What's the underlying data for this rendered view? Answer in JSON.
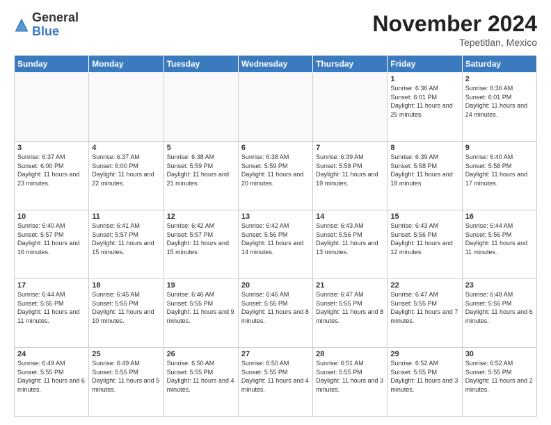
{
  "header": {
    "logo_general": "General",
    "logo_blue": "Blue",
    "title": "November 2024",
    "location": "Tepetitlan, Mexico"
  },
  "calendar": {
    "days_of_week": [
      "Sunday",
      "Monday",
      "Tuesday",
      "Wednesday",
      "Thursday",
      "Friday",
      "Saturday"
    ],
    "weeks": [
      [
        {
          "day": "",
          "empty": true
        },
        {
          "day": "",
          "empty": true
        },
        {
          "day": "",
          "empty": true
        },
        {
          "day": "",
          "empty": true
        },
        {
          "day": "",
          "empty": true
        },
        {
          "day": "1",
          "sunrise": "Sunrise: 6:36 AM",
          "sunset": "Sunset: 6:01 PM",
          "daylight": "Daylight: 11 hours and 25 minutes."
        },
        {
          "day": "2",
          "sunrise": "Sunrise: 6:36 AM",
          "sunset": "Sunset: 6:01 PM",
          "daylight": "Daylight: 11 hours and 24 minutes."
        }
      ],
      [
        {
          "day": "3",
          "sunrise": "Sunrise: 6:37 AM",
          "sunset": "Sunset: 6:00 PM",
          "daylight": "Daylight: 11 hours and 23 minutes."
        },
        {
          "day": "4",
          "sunrise": "Sunrise: 6:37 AM",
          "sunset": "Sunset: 6:00 PM",
          "daylight": "Daylight: 11 hours and 22 minutes."
        },
        {
          "day": "5",
          "sunrise": "Sunrise: 6:38 AM",
          "sunset": "Sunset: 5:59 PM",
          "daylight": "Daylight: 11 hours and 21 minutes."
        },
        {
          "day": "6",
          "sunrise": "Sunrise: 6:38 AM",
          "sunset": "Sunset: 5:59 PM",
          "daylight": "Daylight: 11 hours and 20 minutes."
        },
        {
          "day": "7",
          "sunrise": "Sunrise: 6:39 AM",
          "sunset": "Sunset: 5:58 PM",
          "daylight": "Daylight: 11 hours and 19 minutes."
        },
        {
          "day": "8",
          "sunrise": "Sunrise: 6:39 AM",
          "sunset": "Sunset: 5:58 PM",
          "daylight": "Daylight: 11 hours and 18 minutes."
        },
        {
          "day": "9",
          "sunrise": "Sunrise: 6:40 AM",
          "sunset": "Sunset: 5:58 PM",
          "daylight": "Daylight: 11 hours and 17 minutes."
        }
      ],
      [
        {
          "day": "10",
          "sunrise": "Sunrise: 6:40 AM",
          "sunset": "Sunset: 5:57 PM",
          "daylight": "Daylight: 11 hours and 16 minutes."
        },
        {
          "day": "11",
          "sunrise": "Sunrise: 6:41 AM",
          "sunset": "Sunset: 5:57 PM",
          "daylight": "Daylight: 11 hours and 15 minutes."
        },
        {
          "day": "12",
          "sunrise": "Sunrise: 6:42 AM",
          "sunset": "Sunset: 5:57 PM",
          "daylight": "Daylight: 11 hours and 15 minutes."
        },
        {
          "day": "13",
          "sunrise": "Sunrise: 6:42 AM",
          "sunset": "Sunset: 5:56 PM",
          "daylight": "Daylight: 11 hours and 14 minutes."
        },
        {
          "day": "14",
          "sunrise": "Sunrise: 6:43 AM",
          "sunset": "Sunset: 5:56 PM",
          "daylight": "Daylight: 11 hours and 13 minutes."
        },
        {
          "day": "15",
          "sunrise": "Sunrise: 6:43 AM",
          "sunset": "Sunset: 5:56 PM",
          "daylight": "Daylight: 11 hours and 12 minutes."
        },
        {
          "day": "16",
          "sunrise": "Sunrise: 6:44 AM",
          "sunset": "Sunset: 5:56 PM",
          "daylight": "Daylight: 11 hours and 11 minutes."
        }
      ],
      [
        {
          "day": "17",
          "sunrise": "Sunrise: 6:44 AM",
          "sunset": "Sunset: 5:55 PM",
          "daylight": "Daylight: 11 hours and 11 minutes."
        },
        {
          "day": "18",
          "sunrise": "Sunrise: 6:45 AM",
          "sunset": "Sunset: 5:55 PM",
          "daylight": "Daylight: 11 hours and 10 minutes."
        },
        {
          "day": "19",
          "sunrise": "Sunrise: 6:46 AM",
          "sunset": "Sunset: 5:55 PM",
          "daylight": "Daylight: 11 hours and 9 minutes."
        },
        {
          "day": "20",
          "sunrise": "Sunrise: 6:46 AM",
          "sunset": "Sunset: 5:55 PM",
          "daylight": "Daylight: 11 hours and 8 minutes."
        },
        {
          "day": "21",
          "sunrise": "Sunrise: 6:47 AM",
          "sunset": "Sunset: 5:55 PM",
          "daylight": "Daylight: 11 hours and 8 minutes."
        },
        {
          "day": "22",
          "sunrise": "Sunrise: 6:47 AM",
          "sunset": "Sunset: 5:55 PM",
          "daylight": "Daylight: 11 hours and 7 minutes."
        },
        {
          "day": "23",
          "sunrise": "Sunrise: 6:48 AM",
          "sunset": "Sunset: 5:55 PM",
          "daylight": "Daylight: 11 hours and 6 minutes."
        }
      ],
      [
        {
          "day": "24",
          "sunrise": "Sunrise: 6:49 AM",
          "sunset": "Sunset: 5:55 PM",
          "daylight": "Daylight: 11 hours and 6 minutes."
        },
        {
          "day": "25",
          "sunrise": "Sunrise: 6:49 AM",
          "sunset": "Sunset: 5:55 PM",
          "daylight": "Daylight: 11 hours and 5 minutes."
        },
        {
          "day": "26",
          "sunrise": "Sunrise: 6:50 AM",
          "sunset": "Sunset: 5:55 PM",
          "daylight": "Daylight: 11 hours and 4 minutes."
        },
        {
          "day": "27",
          "sunrise": "Sunrise: 6:50 AM",
          "sunset": "Sunset: 5:55 PM",
          "daylight": "Daylight: 11 hours and 4 minutes."
        },
        {
          "day": "28",
          "sunrise": "Sunrise: 6:51 AM",
          "sunset": "Sunset: 5:55 PM",
          "daylight": "Daylight: 11 hours and 3 minutes."
        },
        {
          "day": "29",
          "sunrise": "Sunrise: 6:52 AM",
          "sunset": "Sunset: 5:55 PM",
          "daylight": "Daylight: 11 hours and 3 minutes."
        },
        {
          "day": "30",
          "sunrise": "Sunrise: 6:52 AM",
          "sunset": "Sunset: 5:55 PM",
          "daylight": "Daylight: 11 hours and 2 minutes."
        }
      ]
    ]
  }
}
